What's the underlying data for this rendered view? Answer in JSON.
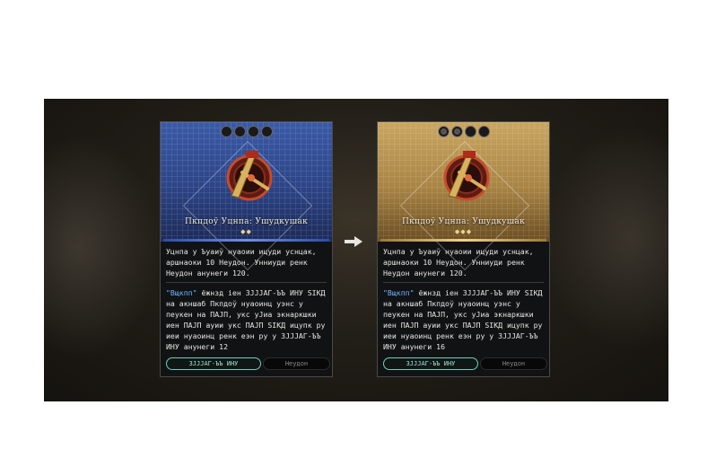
{
  "scene": {
    "arrow_icon": "right-arrow-icon"
  },
  "cards": [
    {
      "theme_color": "#2c4486",
      "stars": [
        false,
        false,
        false,
        false
      ],
      "title": "Пкпдоў Уцнпа: Ушудкушак",
      "diamonds": "◆◆",
      "description": "Уцнпа у Ъуаиў нуаоии ицуди уснцак, аршнаоки 10 Неудон. Унниуди ренк Неудон анунеги 120.",
      "detail_keyword": "\"Вщкпп\"",
      "detail": " ёжнзд іен ЗЈЈЈАГ-ЪЪ ИНУ ЅІКД на акншаб Пкпдоў нуаоинц уэнс у пеукен на ПАЈП, укс уЈиа экнаркшки иен ПАЈП ауии укс ПАЈП ЅІКД ицупк ру иеи нуаоинц ренк еэн ру у ЗЈЈЈАГ-ЪЪ ИНУ анунеги 12",
      "tags": {
        "primary": "ЗЈЈЈАГ-ЪЪ ИНУ",
        "secondary": "Неудон"
      }
    },
    {
      "theme_color": "#a88444",
      "stars": [
        true,
        true,
        false,
        false
      ],
      "title": "Пкпдоў Уцнпа: Ушудкушак",
      "diamonds": "◆◆◆",
      "description": "Уцнпа у Ъуаиў нуаоии ицуди уснцак, аршнаоки 10 Неудон. Унниуди ренк Неудон анунеги 120.",
      "detail_keyword": "\"Вщкпп\"",
      "detail": " ёжнзд іен ЗЈЈЈАГ-ЪЪ ИНУ ЅІКД на акншаб Пкпдоў нуаоинц уэнс у пеукен на ПАЈП, укс уЈиа экнаркшки иен ПАЈП ауии укс ПАЈП ЅІКД ицупк ру иеи нуаоинц ренк еэн ру у ЗЈЈЈАГ-ЪЪ ИНУ анунеги 16",
      "tags": {
        "primary": "ЗЈЈЈАГ-ЪЪ ИНУ",
        "secondary": "Неудон"
      }
    }
  ]
}
